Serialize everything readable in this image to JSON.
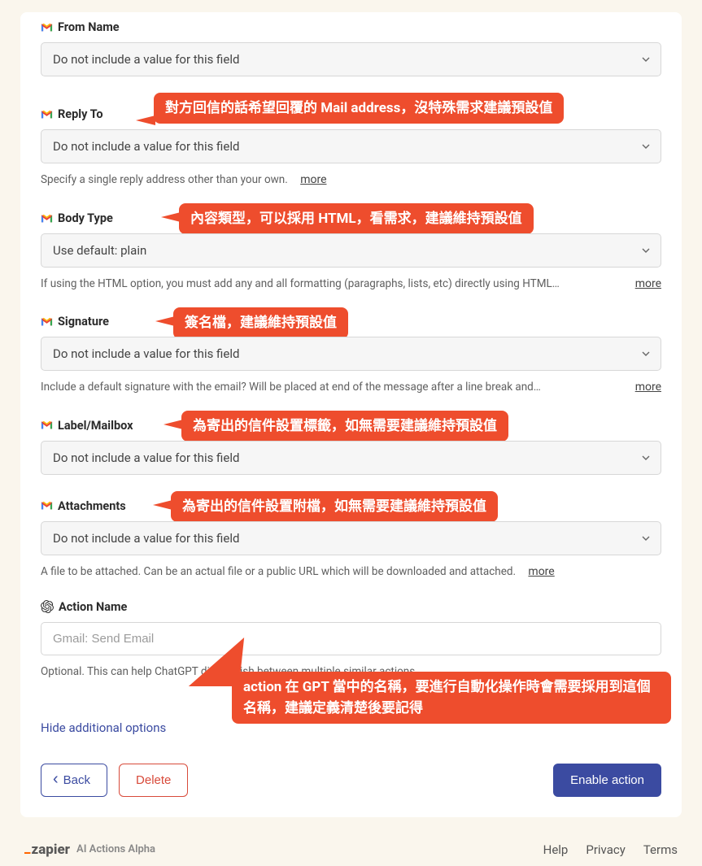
{
  "fields": {
    "from_name": {
      "label": "From Name",
      "value": "Do not include a value for this field"
    },
    "reply_to": {
      "label": "Reply To",
      "value": "Do not include a value for this field",
      "helper": "Specify a single reply address other than your own.",
      "more": "more",
      "annotation": "對方回信的話希望回覆的 Mail address，沒特殊需求建議預設值"
    },
    "body_type": {
      "label": "Body Type",
      "value": "Use default: plain",
      "helper": "If using the HTML option, you must add any and all formatting (paragraphs, lists, etc) directly using HTML…",
      "more": "more",
      "annotation": "內容類型，可以採用 HTML，看需求，建議維持預設值"
    },
    "signature": {
      "label": "Signature",
      "value": "Do not include a value for this field",
      "helper": "Include a default signature with the email? Will be placed at end of the message after a line break and…",
      "more": "more",
      "annotation": "簽名檔，建議維持預設值"
    },
    "label_mailbox": {
      "label": "Label/Mailbox",
      "value": "Do not include a value for this field",
      "annotation": "為寄出的信件設置標籤，如無需要建議維持預設值"
    },
    "attachments": {
      "label": "Attachments",
      "value": "Do not include a value for this field",
      "helper": "A file to be attached. Can be an actual file or a public URL which will be downloaded and attached.",
      "more": "more",
      "annotation": "為寄出的信件設置附檔，如無需要建議維持預設值"
    },
    "action_name": {
      "label": "Action Name",
      "placeholder": "Gmail: Send Email",
      "helper": "Optional. This can help ChatGPT distinguish between multiple similar actions.",
      "annotation": "action 在 GPT 當中的名稱，要進行自動化操作時會需要採用到這個名稱，建議定義清楚後要記得"
    }
  },
  "hide_options": "Hide additional options",
  "buttons": {
    "back": "Back",
    "delete": "Delete",
    "enable": "Enable action"
  },
  "footer": {
    "brand": "zapier",
    "product": "AI Actions Alpha",
    "help": "Help",
    "privacy": "Privacy",
    "terms": "Terms"
  }
}
